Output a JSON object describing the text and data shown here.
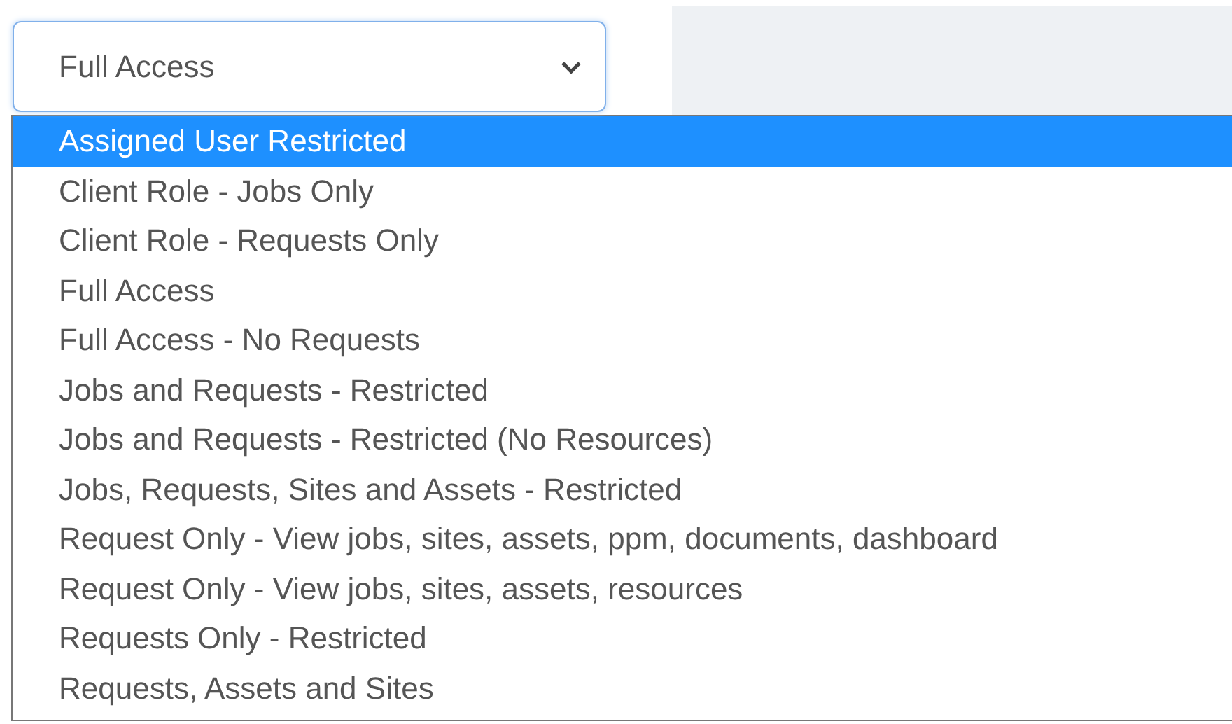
{
  "select": {
    "value": "Full Access",
    "options": [
      {
        "label": "Assigned User Restricted",
        "highlighted": true
      },
      {
        "label": "Client Role - Jobs Only",
        "highlighted": false
      },
      {
        "label": "Client Role - Requests Only",
        "highlighted": false
      },
      {
        "label": "Full Access",
        "highlighted": false
      },
      {
        "label": "Full Access - No Requests",
        "highlighted": false
      },
      {
        "label": "Jobs and Requests - Restricted",
        "highlighted": false
      },
      {
        "label": "Jobs and Requests - Restricted (No Resources)",
        "highlighted": false
      },
      {
        "label": "Jobs, Requests, Sites and Assets - Restricted",
        "highlighted": false
      },
      {
        "label": "Request Only - View jobs, sites, assets, ppm, documents, dashboard",
        "highlighted": false
      },
      {
        "label": "Request Only - View jobs, sites, assets, resources",
        "highlighted": false
      },
      {
        "label": "Requests Only - Restricted",
        "highlighted": false
      },
      {
        "label": "Requests, Assets and Sites",
        "highlighted": false
      }
    ]
  }
}
